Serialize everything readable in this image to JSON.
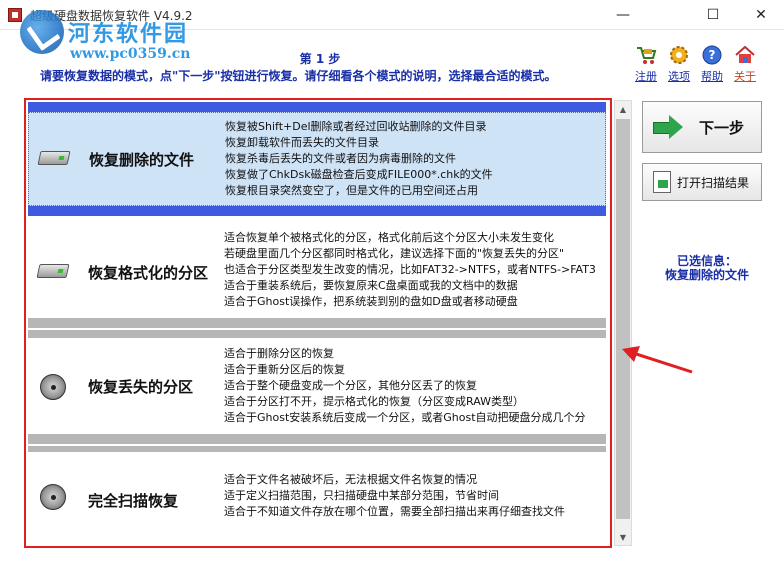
{
  "window": {
    "title": "超级硬盘数据恢复软件 V4.9.2",
    "watermark_name": "河东软件园",
    "watermark_url": "www.pc0359.cn",
    "minimize": "—",
    "maximize": "☐",
    "close": "✕"
  },
  "header": {
    "step": "第 1 步",
    "description": "请要恢复数据的模式，点\"下一步\"按钮进行恢复。请仔细看各个模式的说明，选择最合适的模式。"
  },
  "toolbar": {
    "items": [
      {
        "label": "注册",
        "icon": "cart-icon"
      },
      {
        "label": "选项",
        "icon": "gear-icon"
      },
      {
        "label": "帮助",
        "icon": "help-icon"
      },
      {
        "label": "关于",
        "icon": "home-icon"
      }
    ]
  },
  "modes": [
    {
      "title": "恢复删除的文件",
      "selected": true,
      "lines": [
        "恢复被Shift+Del删除或者经过回收站删除的文件目录",
        "恢复卸载软件而丢失的文件目录",
        "恢复杀毒后丢失的文件或者因为病毒删除的文件",
        "恢复做了ChkDsk磁盘检查后变成FILE000*.chk的文件",
        "恢复根目录突然变空了，但是文件的已用空间还占用"
      ]
    },
    {
      "title": "恢复格式化的分区",
      "selected": false,
      "lines": [
        "适合恢复单个被格式化的分区，格式化前后这个分区大小未发生变化",
        "若硬盘里面几个分区都同时格式化，建议选择下面的\"恢复丢失的分区\"",
        "也适合于分区类型发生改变的情况，比如FAT32->NTFS，或者NTFS->FAT3",
        "适合于重装系统后，要恢复原来C盘桌面或我的文档中的数据",
        "适合于Ghost误操作，把系统装到别的盘如D盘或者移动硬盘"
      ]
    },
    {
      "title": "恢复丢失的分区",
      "selected": false,
      "lines": [
        "适合于删除分区的恢复",
        "适合于重新分区后的恢复",
        "适合于整个硬盘变成一个分区，其他分区丢了的恢复",
        "适合于分区打不开，提示格式化的恢复（分区变成RAW类型）",
        "适合于Ghost安装系统后变成一个分区，或者Ghost自动把硬盘分成几个分"
      ]
    },
    {
      "title": "完全扫描恢复",
      "selected": false,
      "lines": [
        "适合于文件名被破坏后，无法根据文件名恢复的情况",
        "适于定义扫描范围，只扫描硬盘中某部分范围，节省时间",
        "适合于不知道文件存放在哪个位置，需要全部扫描出来再仔细查找文件"
      ]
    }
  ],
  "scrollbar": {
    "up": "▲",
    "down": "▼"
  },
  "sidebar": {
    "next_label": "下一步",
    "open_scan_label": "打开扫描结果",
    "info_label": "已选信息：",
    "info_value": "恢复删除的文件"
  },
  "colors": {
    "accent_blue": "#1a2fa6",
    "selected_row": "#cfe3f7",
    "separator_blue": "#3e5ae0",
    "separator_gray": "#b6b6b6",
    "annotation_red": "#e02020"
  }
}
